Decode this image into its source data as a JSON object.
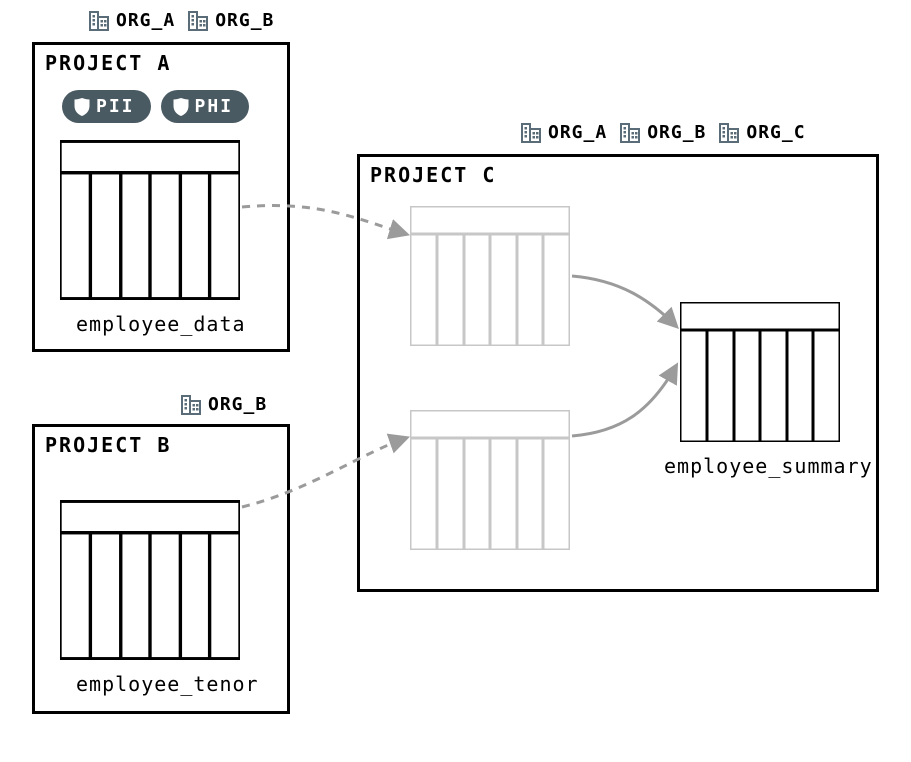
{
  "projects": {
    "a": {
      "title": "PROJECT A",
      "orgs": [
        "ORG_A",
        "ORG_B"
      ],
      "tags": [
        "PII",
        "PHI"
      ],
      "table": "employee_data"
    },
    "b": {
      "title": "PROJECT B",
      "orgs": [
        "ORG_B"
      ],
      "table": "employee_tenor"
    },
    "c": {
      "title": "PROJECT C",
      "orgs": [
        "ORG_A",
        "ORG_B",
        "ORG_C"
      ],
      "table": "employee_summary"
    }
  },
  "flows": [
    {
      "from": "project_a.table",
      "to": "project_c.intermediate_1",
      "style": "dashed"
    },
    {
      "from": "project_b.table",
      "to": "project_c.intermediate_2",
      "style": "dashed"
    },
    {
      "from": "project_c.intermediate_1",
      "to": "project_c.output",
      "style": "solid"
    },
    {
      "from": "project_c.intermediate_2",
      "to": "project_c.output",
      "style": "solid"
    }
  ]
}
